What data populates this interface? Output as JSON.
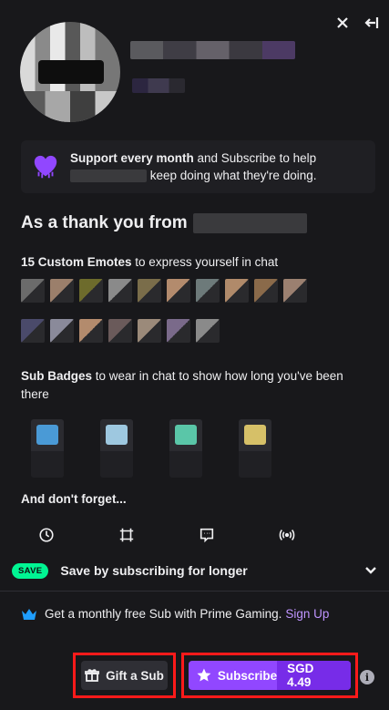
{
  "header": {
    "close_label": "×",
    "collapse_label": "←|"
  },
  "support": {
    "bold": "Support every month",
    "text_a": " and Subscribe to help",
    "text_b": "keep doing what they're doing."
  },
  "thanks": {
    "title": "As a thank you from"
  },
  "emotes": {
    "bold": "15 Custom Emotes",
    "text": " to express yourself in chat",
    "colors_row1": [
      "#6b6b6b",
      "#9b7f6b",
      "#6d6b2c",
      "#8a8a8a",
      "#7a6d4a",
      "#b38b6d",
      "#6d7a7a",
      "#b08a6a",
      "#8a6a4a",
      "#9b8070"
    ],
    "colors_row2": [
      "#4a4a6a",
      "#8a8a9a",
      "#b38b6d",
      "#6a5a5a",
      "#9b8a7a",
      "#7a6a8a",
      "#8a8a8a"
    ]
  },
  "badges": {
    "bold": "Sub Badges",
    "text": " to wear in chat to show how long you've been there",
    "colors": [
      "#4a9ad6",
      "#9ec8e0",
      "#5ac6a8",
      "#d6c068"
    ]
  },
  "forget": {
    "title": "And don't forget..."
  },
  "perks": {
    "icons": [
      "clock-icon",
      "frame-icon",
      "chat-icon",
      "broadcast-icon"
    ]
  },
  "save": {
    "pill": "SAVE",
    "label": "Save by subscribing for longer"
  },
  "prime": {
    "text": "Get a monthly free Sub with Prime Gaming.",
    "link": "Sign Up"
  },
  "actions": {
    "gift_label": "Gift a Sub",
    "subscribe_label": "Subscribe",
    "price": "SGD 4.49",
    "info": "i"
  },
  "colors": {
    "accent": "#9147ff",
    "accent_dark": "#772ce8",
    "save_green": "#00f593",
    "link": "#bf94ff"
  }
}
